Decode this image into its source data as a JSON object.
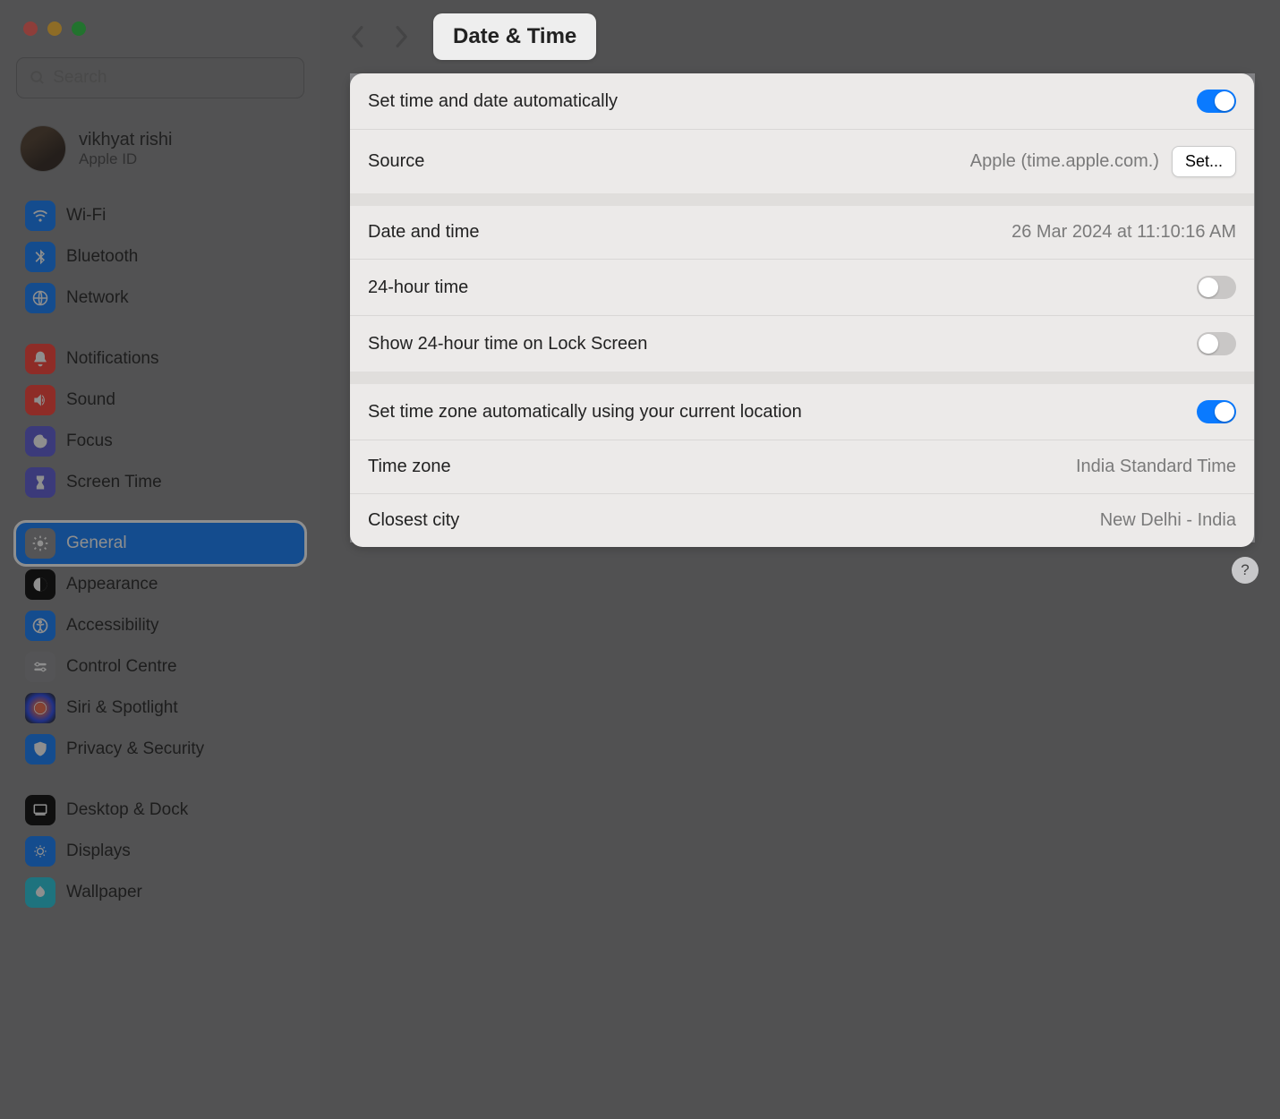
{
  "header": {
    "title": "Date & Time"
  },
  "search": {
    "placeholder": "Search"
  },
  "user": {
    "name": "vikhyat rishi",
    "sub": "Apple ID"
  },
  "sidebar": {
    "group1": [
      {
        "label": "Wi-Fi",
        "icon": "wifi-icon",
        "style": "ic-wifi"
      },
      {
        "label": "Bluetooth",
        "icon": "bluetooth-icon",
        "style": "ic-bt"
      },
      {
        "label": "Network",
        "icon": "network-icon",
        "style": "ic-net"
      }
    ],
    "group2": [
      {
        "label": "Notifications",
        "icon": "notifications-icon",
        "style": "ic-notif"
      },
      {
        "label": "Sound",
        "icon": "sound-icon",
        "style": "ic-sound"
      },
      {
        "label": "Focus",
        "icon": "focus-icon",
        "style": "ic-focus"
      },
      {
        "label": "Screen Time",
        "icon": "screentime-icon",
        "style": "ic-screentime"
      }
    ],
    "group3": [
      {
        "label": "General",
        "icon": "general-icon",
        "style": "ic-general",
        "selected": true
      },
      {
        "label": "Appearance",
        "icon": "appearance-icon",
        "style": "ic-appear"
      },
      {
        "label": "Accessibility",
        "icon": "accessibility-icon",
        "style": "ic-access"
      },
      {
        "label": "Control Centre",
        "icon": "control-centre-icon",
        "style": "ic-control"
      },
      {
        "label": "Siri & Spotlight",
        "icon": "siri-icon",
        "style": "ic-siri"
      },
      {
        "label": "Privacy & Security",
        "icon": "privacy-icon",
        "style": "ic-privacy"
      }
    ],
    "group4": [
      {
        "label": "Desktop & Dock",
        "icon": "desktop-icon",
        "style": "ic-desktop"
      },
      {
        "label": "Displays",
        "icon": "displays-icon",
        "style": "ic-displays"
      },
      {
        "label": "Wallpaper",
        "icon": "wallpaper-icon",
        "style": "ic-wallpaper"
      }
    ]
  },
  "settings": {
    "auto_time_label": "Set time and date automatically",
    "auto_time_on": true,
    "source_label": "Source",
    "source_value": "Apple (time.apple.com.)",
    "set_button": "Set...",
    "date_time_label": "Date and time",
    "date_time_value": "26 Mar 2024 at 11:10:16 AM",
    "h24_label": "24-hour time",
    "h24_on": false,
    "h24_lock_label": "Show 24-hour time on Lock Screen",
    "h24_lock_on": false,
    "auto_tz_label": "Set time zone automatically using your current location",
    "auto_tz_on": true,
    "tz_label": "Time zone",
    "tz_value": "India Standard Time",
    "city_label": "Closest city",
    "city_value": "New Delhi - India"
  },
  "help": "?"
}
